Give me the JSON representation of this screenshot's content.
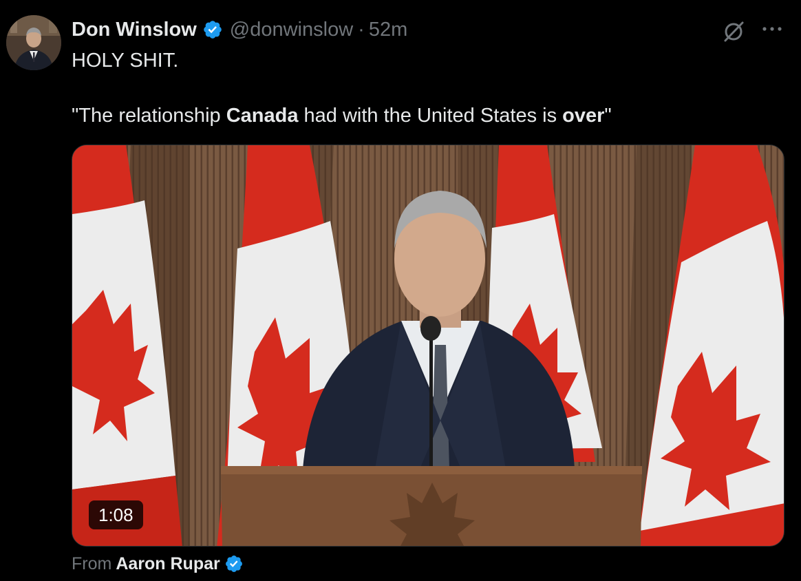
{
  "author": {
    "display_name": "Don Winslow",
    "handle": "@donwinslow",
    "separator": "·",
    "time_ago": "52m",
    "verified": true
  },
  "tweet": {
    "line1": "HOLY SHIT.",
    "quote_open": "\"The relationship ",
    "quote_bold1": "Canada",
    "quote_mid": " had with the United States is ",
    "quote_bold2": "over",
    "quote_close": "\""
  },
  "media": {
    "type": "video",
    "duration": "1:08"
  },
  "source": {
    "from_label": "From",
    "name": "Aaron Rupar",
    "verified": true
  },
  "icons": {
    "verified_badge": "verified-badge-icon",
    "grok": "grok-icon",
    "more": "more-icon"
  },
  "colors": {
    "background": "#000000",
    "text_primary": "#e7e9ea",
    "text_secondary": "#71767b",
    "verified_blue": "#1d9bf0",
    "flag_red": "#d52b1e"
  }
}
